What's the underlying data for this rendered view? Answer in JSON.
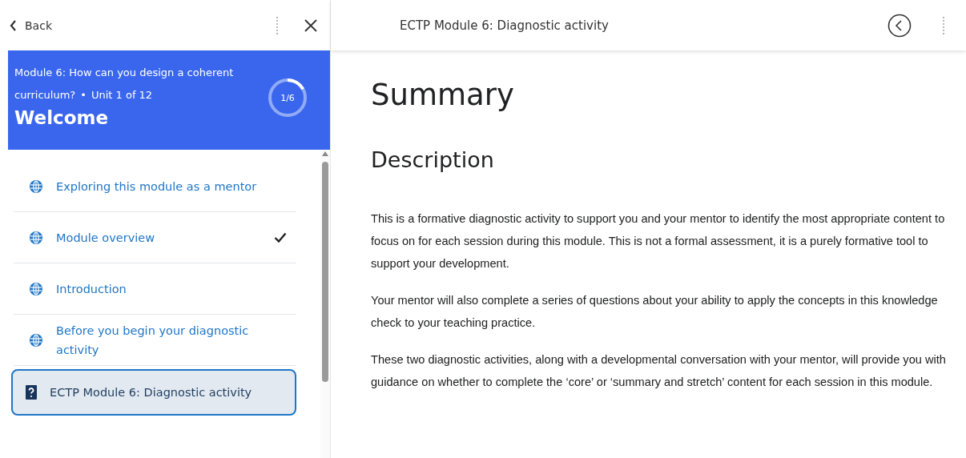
{
  "sidebar": {
    "back_label": "Back",
    "header": {
      "module_title": "Module 6: How can you design a coherent curriculum?",
      "separator": "•",
      "unit": "Unit 1 of 12",
      "title": "Welcome",
      "progress_label": "1/6"
    },
    "items": [
      {
        "kind": "page",
        "label": "Exploring this module as a mentor",
        "completed": false,
        "selected": false
      },
      {
        "kind": "page",
        "label": "Module overview",
        "completed": true,
        "selected": false
      },
      {
        "kind": "page",
        "label": "Introduction",
        "completed": false,
        "selected": false
      },
      {
        "kind": "page",
        "label": "Before you begin your diagnostic activity",
        "completed": false,
        "selected": false
      },
      {
        "kind": "quiz",
        "label": "ECTP Module 6: Diagnostic activity",
        "completed": false,
        "selected": true
      }
    ]
  },
  "content": {
    "topbar_title": "ECTP Module 6: Diagnostic activity",
    "heading": "Summary",
    "subheading": "Description",
    "paragraphs": [
      "This is a formative diagnostic activity to support you and your mentor to identify the most appropriate content to focus on for each session during this module. This is not a formal assessment, it is a purely formative tool to support your development.",
      "Your mentor will also complete a series of questions about your ability to apply the concepts in this knowledge check to your teaching practice.",
      "These two diagnostic activities, along with a developmental conversation with your mentor, will provide you with guidance on whether to complete the ‘core’ or ‘summary and stretch’ content for each session in this module."
    ]
  }
}
